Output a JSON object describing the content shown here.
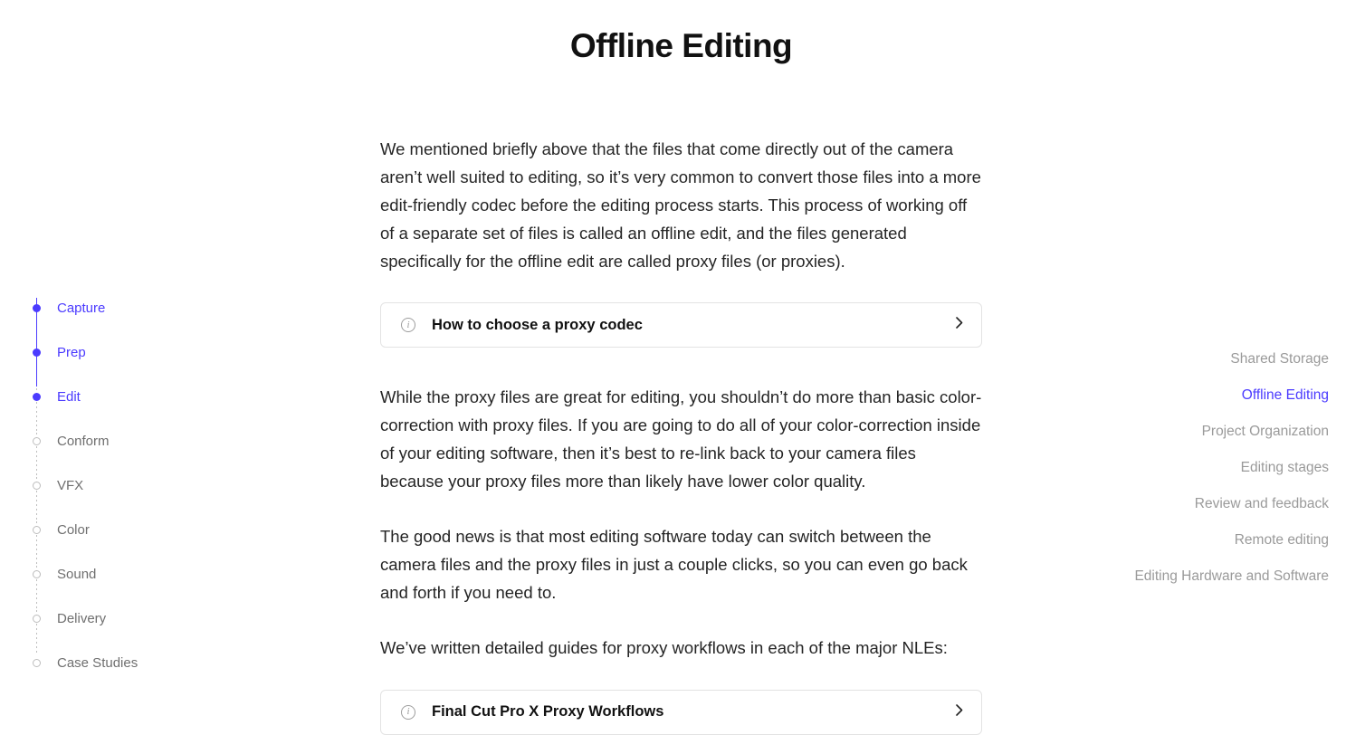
{
  "leftNav": {
    "items": [
      {
        "label": "Capture",
        "active": true,
        "filled": true
      },
      {
        "label": "Prep",
        "active": true,
        "filled": true
      },
      {
        "label": "Edit",
        "active": true,
        "filled": true
      },
      {
        "label": "Conform",
        "active": false,
        "filled": false
      },
      {
        "label": "VFX",
        "active": false,
        "filled": false
      },
      {
        "label": "Color",
        "active": false,
        "filled": false
      },
      {
        "label": "Sound",
        "active": false,
        "filled": false
      },
      {
        "label": "Delivery",
        "active": false,
        "filled": false
      },
      {
        "label": "Case Studies",
        "active": false,
        "filled": false
      }
    ]
  },
  "main": {
    "title": "Offline Editing",
    "para1": "We mentioned briefly above that the files that come directly out of the camera aren’t well suited to editing, so it’s very common to convert those files into a more edit-friendly codec before the editing process starts. This process of working off of a separate set of files is called an offline edit, and the files generated specifically for the offline edit are called proxy files (or proxies).",
    "card1": "How to choose a proxy codec",
    "para2": "While the proxy files are great for editing, you shouldn’t do more than basic color-correction with proxy files. If you are going to do all of your color-correction inside of your editing software, then it’s best to re-link back to your camera files because your proxy files more than likely have lower color quality.",
    "para3": "The good news is that most editing software today can switch between the camera files and the proxy files in just a couple clicks, so you can even go back and forth if you need to.",
    "para4": "We’ve written detailed guides for proxy workflows in each of the major NLEs:",
    "card2": "Final Cut Pro X Proxy Workflows"
  },
  "rightNav": {
    "items": [
      {
        "label": "Shared Storage",
        "active": false
      },
      {
        "label": "Offline Editing",
        "active": true
      },
      {
        "label": "Project Organization",
        "active": false
      },
      {
        "label": "Editing stages",
        "active": false
      },
      {
        "label": "Review and feedback",
        "active": false
      },
      {
        "label": "Remote editing",
        "active": false
      },
      {
        "label": "Editing Hardware and Software",
        "active": false
      }
    ]
  }
}
